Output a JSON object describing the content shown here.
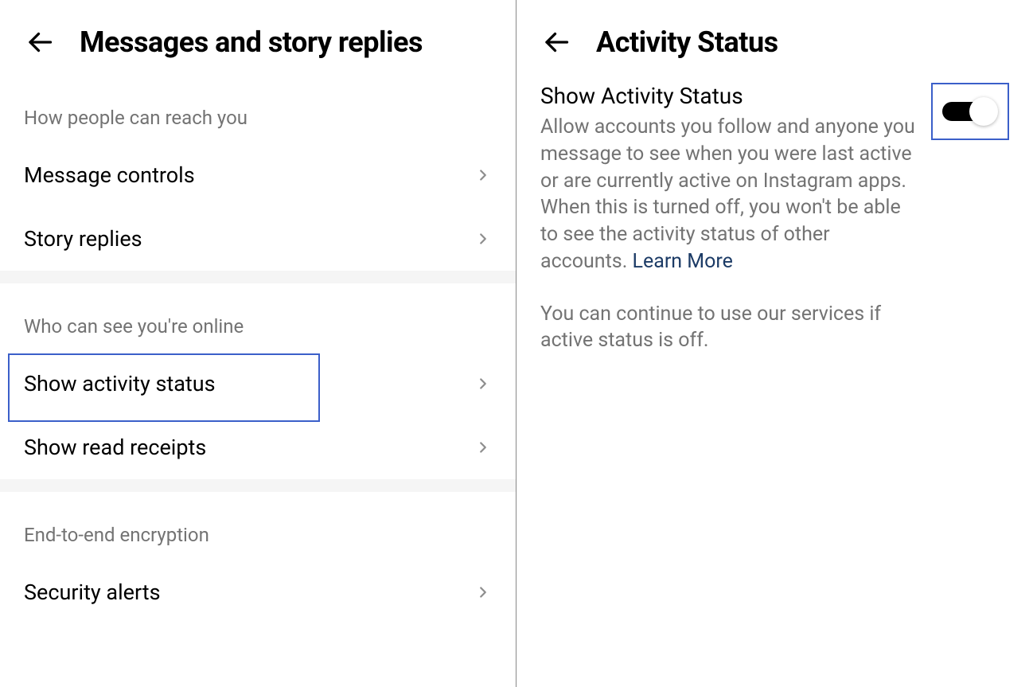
{
  "left": {
    "title": "Messages and story replies",
    "sections": [
      {
        "label": "How people can reach you",
        "items": [
          {
            "label": "Message controls"
          },
          {
            "label": "Story replies"
          }
        ]
      },
      {
        "label": "Who can see you're online",
        "items": [
          {
            "label": "Show activity status",
            "highlighted": true
          },
          {
            "label": "Show read receipts"
          }
        ]
      },
      {
        "label": "End-to-end encryption",
        "items": [
          {
            "label": "Security alerts"
          }
        ]
      }
    ]
  },
  "right": {
    "title": "Activity Status",
    "setting": {
      "title": "Show Activity Status",
      "description": "Allow accounts you follow and anyone you message to see when you were last active or are currently active on Instagram apps. When this is turned off, you won't be able to see the activity status of other accounts. ",
      "learn_more": "Learn More",
      "note": "You can continue to use our services if active status is off.",
      "toggle_on": true
    }
  }
}
